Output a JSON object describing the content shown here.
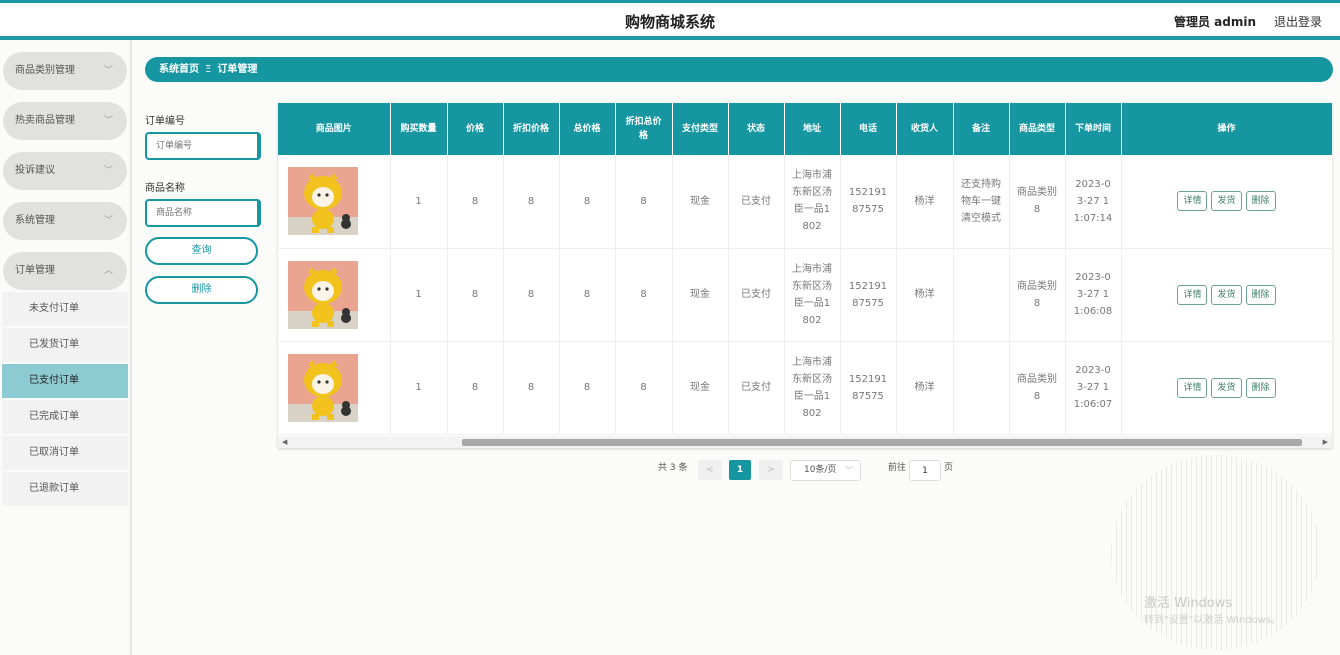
{
  "header": {
    "title": "购物商城系统",
    "admin_label": "管理员 admin",
    "logout": "退出登录"
  },
  "sidebar": {
    "menus": [
      {
        "label": "商品类别管理"
      },
      {
        "label": "热卖商品管理"
      },
      {
        "label": "投诉建议"
      },
      {
        "label": "系统管理"
      },
      {
        "label": "订单管理"
      }
    ],
    "sub_items": [
      {
        "label": "未支付订单"
      },
      {
        "label": "已发货订单"
      },
      {
        "label": "已支付订单"
      },
      {
        "label": "已完成订单"
      },
      {
        "label": "已取消订单"
      },
      {
        "label": "已退款订单"
      }
    ],
    "active_sub": "已支付订单"
  },
  "breadcrumb": {
    "home": "系统首页",
    "separator": "Ξ",
    "current": "订单管理"
  },
  "search": {
    "order_no_label": "订单编号",
    "order_no_placeholder": "订单编号",
    "product_name_label": "商品名称",
    "product_name_placeholder": "商品名称",
    "query_button": "查询",
    "delete_button": "删除"
  },
  "table": {
    "columns": [
      "商品图片",
      "购买数量",
      "价格",
      "折扣价格",
      "总价格",
      "折扣总价格",
      "支付类型",
      "状态",
      "地址",
      "电话",
      "收货人",
      "备注",
      "商品类型",
      "下单时间",
      "操作"
    ],
    "rows": [
      {
        "quantity": "1",
        "price": "8",
        "discount_price": "8",
        "total": "8",
        "discount_total": "8",
        "pay_type": "现金",
        "status": "已支付",
        "address": "上海市浦东新区汤臣一品1802",
        "phone": "15219187575",
        "receiver": "杨洋",
        "remark": "还支持购物车一键清空模式",
        "product_type": "商品类别8",
        "time": "2023-03-27 11:07:14"
      },
      {
        "quantity": "1",
        "price": "8",
        "discount_price": "8",
        "total": "8",
        "discount_total": "8",
        "pay_type": "现金",
        "status": "已支付",
        "address": "上海市浦东新区汤臣一品1802",
        "phone": "15219187575",
        "receiver": "杨洋",
        "remark": "",
        "product_type": "商品类别8",
        "time": "2023-03-27 11:06:08"
      },
      {
        "quantity": "1",
        "price": "8",
        "discount_price": "8",
        "total": "8",
        "discount_total": "8",
        "pay_type": "现金",
        "status": "已支付",
        "address": "上海市浦东新区汤臣一品1802",
        "phone": "15219187575",
        "receiver": "杨洋",
        "remark": "",
        "product_type": "商品类别8",
        "time": "2023-03-27 11:06:07"
      }
    ],
    "actions": {
      "detail": "详情",
      "ship": "发货",
      "delete": "删除"
    }
  },
  "pagination": {
    "total_text": "共 3 条",
    "prev": "<",
    "current_page": "1",
    "next": ">",
    "page_size": "10条/页",
    "goto_label": "前往",
    "goto_value": "1",
    "page_unit": "页"
  },
  "watermark": {
    "title": "激活 Windows",
    "subtitle": "转到\"设置\"以激活 Windows。"
  },
  "colors": {
    "accent": "#1596a1",
    "active_sub": "#8dcbd2",
    "menu_pill": "#e1e1e0"
  }
}
